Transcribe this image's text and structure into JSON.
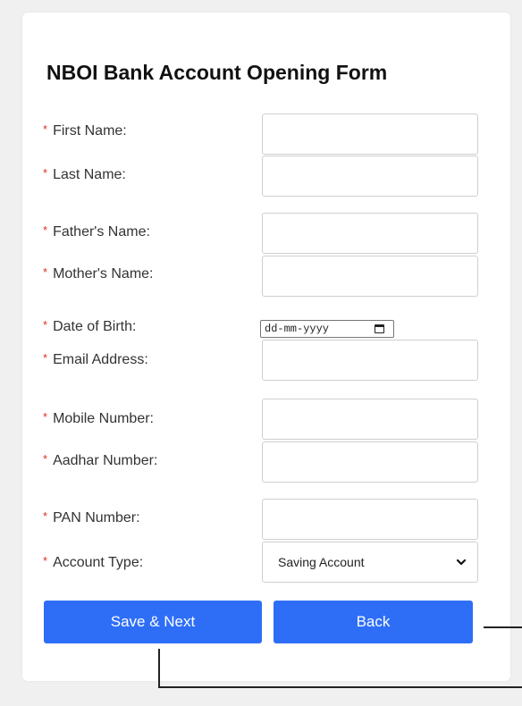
{
  "form": {
    "title": "NBOI Bank Account Opening Form",
    "required_mark": "*",
    "fields": {
      "first_name": {
        "label": "First Name:",
        "value": ""
      },
      "last_name": {
        "label": "Last Name:",
        "value": ""
      },
      "father_name": {
        "label": "Father's Name:",
        "value": ""
      },
      "mother_name": {
        "label": "Mother's Name:",
        "value": ""
      },
      "dob": {
        "label": "Date of Birth:",
        "placeholder": "dd-mm-yyyy"
      },
      "email": {
        "label": "Email Address:",
        "value": ""
      },
      "mobile": {
        "label": "Mobile Number:",
        "value": ""
      },
      "aadhar": {
        "label": "Aadhar Number:",
        "value": ""
      },
      "pan": {
        "label": "PAN Number:",
        "value": ""
      },
      "account_type": {
        "label": "Account Type:",
        "selected": "Saving Account"
      }
    },
    "buttons": {
      "save_next": "Save & Next",
      "back": "Back"
    },
    "colors": {
      "button": "#2e6ef7",
      "required": "#d93025",
      "background": "#f0f0f0"
    }
  }
}
